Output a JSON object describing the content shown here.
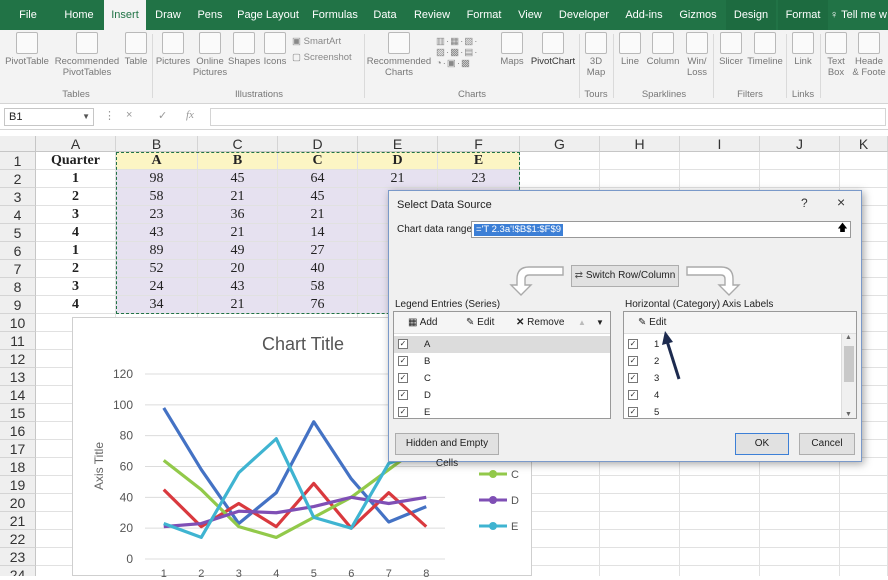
{
  "ribbon_tabs": [
    "File",
    "Home",
    "Insert",
    "Draw",
    "Pens",
    "Page Layout",
    "Formulas",
    "Data",
    "Review",
    "Format",
    "View",
    "Developer",
    "Add-ins",
    "Gizmos",
    "Design",
    "Format",
    "Tell me w"
  ],
  "active_tab": "Insert",
  "ribbon": {
    "pivot_table": "PivotTable",
    "recommended_pivot": [
      "Recommended",
      "PivotTables"
    ],
    "table": "Table",
    "pictures": "Pictures",
    "online_pictures": [
      "Online",
      "Pictures"
    ],
    "shapes": "Shapes",
    "icons": "Icons",
    "smartart": "SmartArt",
    "screenshot": "Screenshot",
    "recommended_charts": [
      "Recommended",
      "Charts"
    ],
    "maps": "Maps",
    "pivot_chart": "PivotChart",
    "map3d": [
      "3D",
      "Map"
    ],
    "line": "Line",
    "column": "Column",
    "winloss": [
      "Win/",
      "Loss"
    ],
    "slicer": "Slicer",
    "timeline": "Timeline",
    "link": "Link",
    "textbox": [
      "Text",
      "Box"
    ],
    "header_footer": [
      "Heade",
      "& Foote"
    ],
    "groups": [
      "Tables",
      "Illustrations",
      "Charts",
      "Tours",
      "Sparklines",
      "Filters",
      "Links"
    ]
  },
  "formula_bar": {
    "name_box": "B1",
    "cancel": "×",
    "enter": "✓",
    "fx": "fx"
  },
  "sheet": {
    "columns": [
      "A",
      "B",
      "C",
      "D",
      "E",
      "F",
      "G",
      "H",
      "I",
      "J",
      "K"
    ],
    "rows": [
      "1",
      "2",
      "3",
      "4",
      "5",
      "6",
      "7",
      "8",
      "9",
      "10",
      "11",
      "12",
      "13",
      "14",
      "15",
      "16",
      "17",
      "18",
      "19",
      "20",
      "21",
      "22",
      "23",
      "24"
    ],
    "header_row": [
      "Quarter",
      "A",
      "B",
      "C",
      "D",
      "E"
    ],
    "data": [
      [
        "1",
        "98",
        "45",
        "64",
        "21",
        "23"
      ],
      [
        "2",
        "58",
        "21",
        "45",
        "",
        ""
      ],
      [
        "3",
        "23",
        "36",
        "21",
        "",
        ""
      ],
      [
        "4",
        "43",
        "21",
        "14",
        "",
        ""
      ],
      [
        "1",
        "89",
        "49",
        "27",
        "",
        ""
      ],
      [
        "2",
        "52",
        "20",
        "40",
        "",
        ""
      ],
      [
        "3",
        "24",
        "43",
        "58",
        "",
        ""
      ],
      [
        "4",
        "34",
        "21",
        "76",
        "",
        ""
      ]
    ]
  },
  "chart_data": {
    "type": "line",
    "title": "Chart Title",
    "ylabel": "Axis Title",
    "x": [
      "1",
      "2",
      "3",
      "4",
      "5",
      "6",
      "7",
      "8"
    ],
    "ylim": [
      0,
      120
    ],
    "yticks": [
      0,
      20,
      40,
      60,
      80,
      100,
      120
    ],
    "series": [
      {
        "name": "A",
        "values": [
          98,
          58,
          23,
          43,
          89,
          52,
          24,
          34
        ],
        "color": "#4472c4"
      },
      {
        "name": "B",
        "values": [
          45,
          21,
          36,
          21,
          49,
          20,
          43,
          21
        ],
        "color": "#d9393e"
      },
      {
        "name": "C",
        "values": [
          64,
          45,
          21,
          14,
          27,
          40,
          58,
          76
        ],
        "color": "#92c94a"
      },
      {
        "name": "D",
        "values": [
          21,
          23,
          31,
          30,
          34,
          40,
          36,
          40
        ],
        "color": "#7f4fb5"
      },
      {
        "name": "E",
        "values": [
          23,
          14,
          56,
          78,
          27,
          20,
          62,
          71
        ],
        "color": "#3fb4d1"
      }
    ],
    "legend_visible": [
      "C",
      "D",
      "E"
    ],
    "legend_position": "right"
  },
  "dialog": {
    "title": "Select Data Source",
    "help": "?",
    "close": "×",
    "range_label": "Chart data range:",
    "range_value": "='T 2.3a'!$B$1:$F$9",
    "switch_button": "Switch Row/Column",
    "legend_title": "Legend Entries (Series)",
    "legend_add": "Add",
    "legend_edit": "Edit",
    "legend_remove": "Remove",
    "series": [
      "A",
      "B",
      "C",
      "D",
      "E"
    ],
    "axis_title": "Horizontal (Category) Axis Labels",
    "axis_edit": "Edit",
    "categories": [
      "1",
      "2",
      "3",
      "4",
      "5"
    ],
    "hidden_cells": "Hidden and Empty Cells",
    "ok": "OK",
    "cancel": "Cancel"
  },
  "colors": {
    "excel_green": "#217346",
    "header_fill": "#fcf5c4",
    "data_fill": "#e6e1f0",
    "selection": "#3c7fd6"
  }
}
